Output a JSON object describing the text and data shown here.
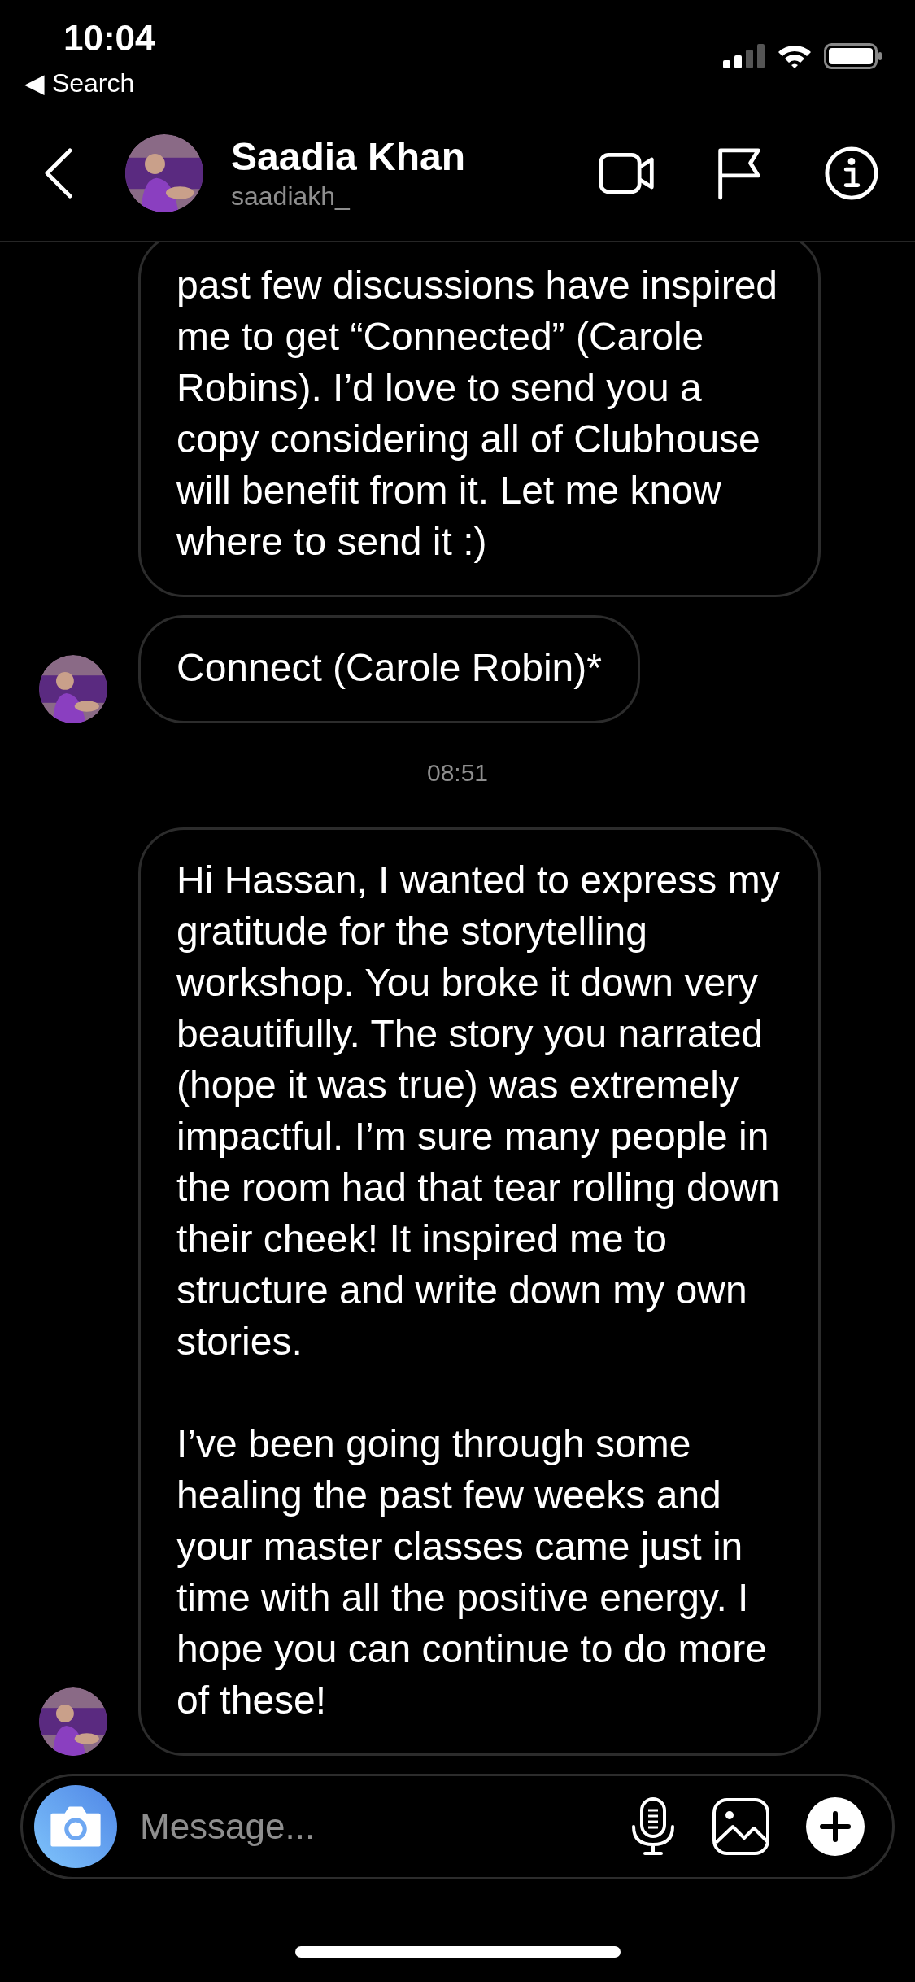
{
  "status_bar": {
    "time": "10:04",
    "back_label": "◀ Search"
  },
  "header": {
    "name": "Saadia Khan",
    "username": "saadiakh_"
  },
  "messages": [
    {
      "kind": "bubble",
      "avatar": false,
      "paragraphs": [
        "past few discussions have inspired me to get “Connected” (Carole Robins). I’d love to send you a copy considering all of Clubhouse will benefit from it. Let me know where to send it :)"
      ]
    },
    {
      "kind": "bubble",
      "avatar": true,
      "paragraphs": [
        "Connect (Carole Robin)*"
      ]
    },
    {
      "kind": "timestamp",
      "text": "08:51"
    },
    {
      "kind": "bubble",
      "avatar": true,
      "paragraphs": [
        "Hi Hassan, I wanted to express my gratitude for the storytelling workshop. You broke it down very beautifully. The story you narrated (hope it was true) was extremely impactful. I’m sure many people in the room had that tear rolling down their cheek! It inspired me to structure and write down my own stories.",
        "I’ve been going through some healing the past few weeks and your master classes came just in time with all the positive energy. I hope you can continue to do more of these!"
      ]
    }
  ],
  "composer": {
    "placeholder": "Message..."
  }
}
